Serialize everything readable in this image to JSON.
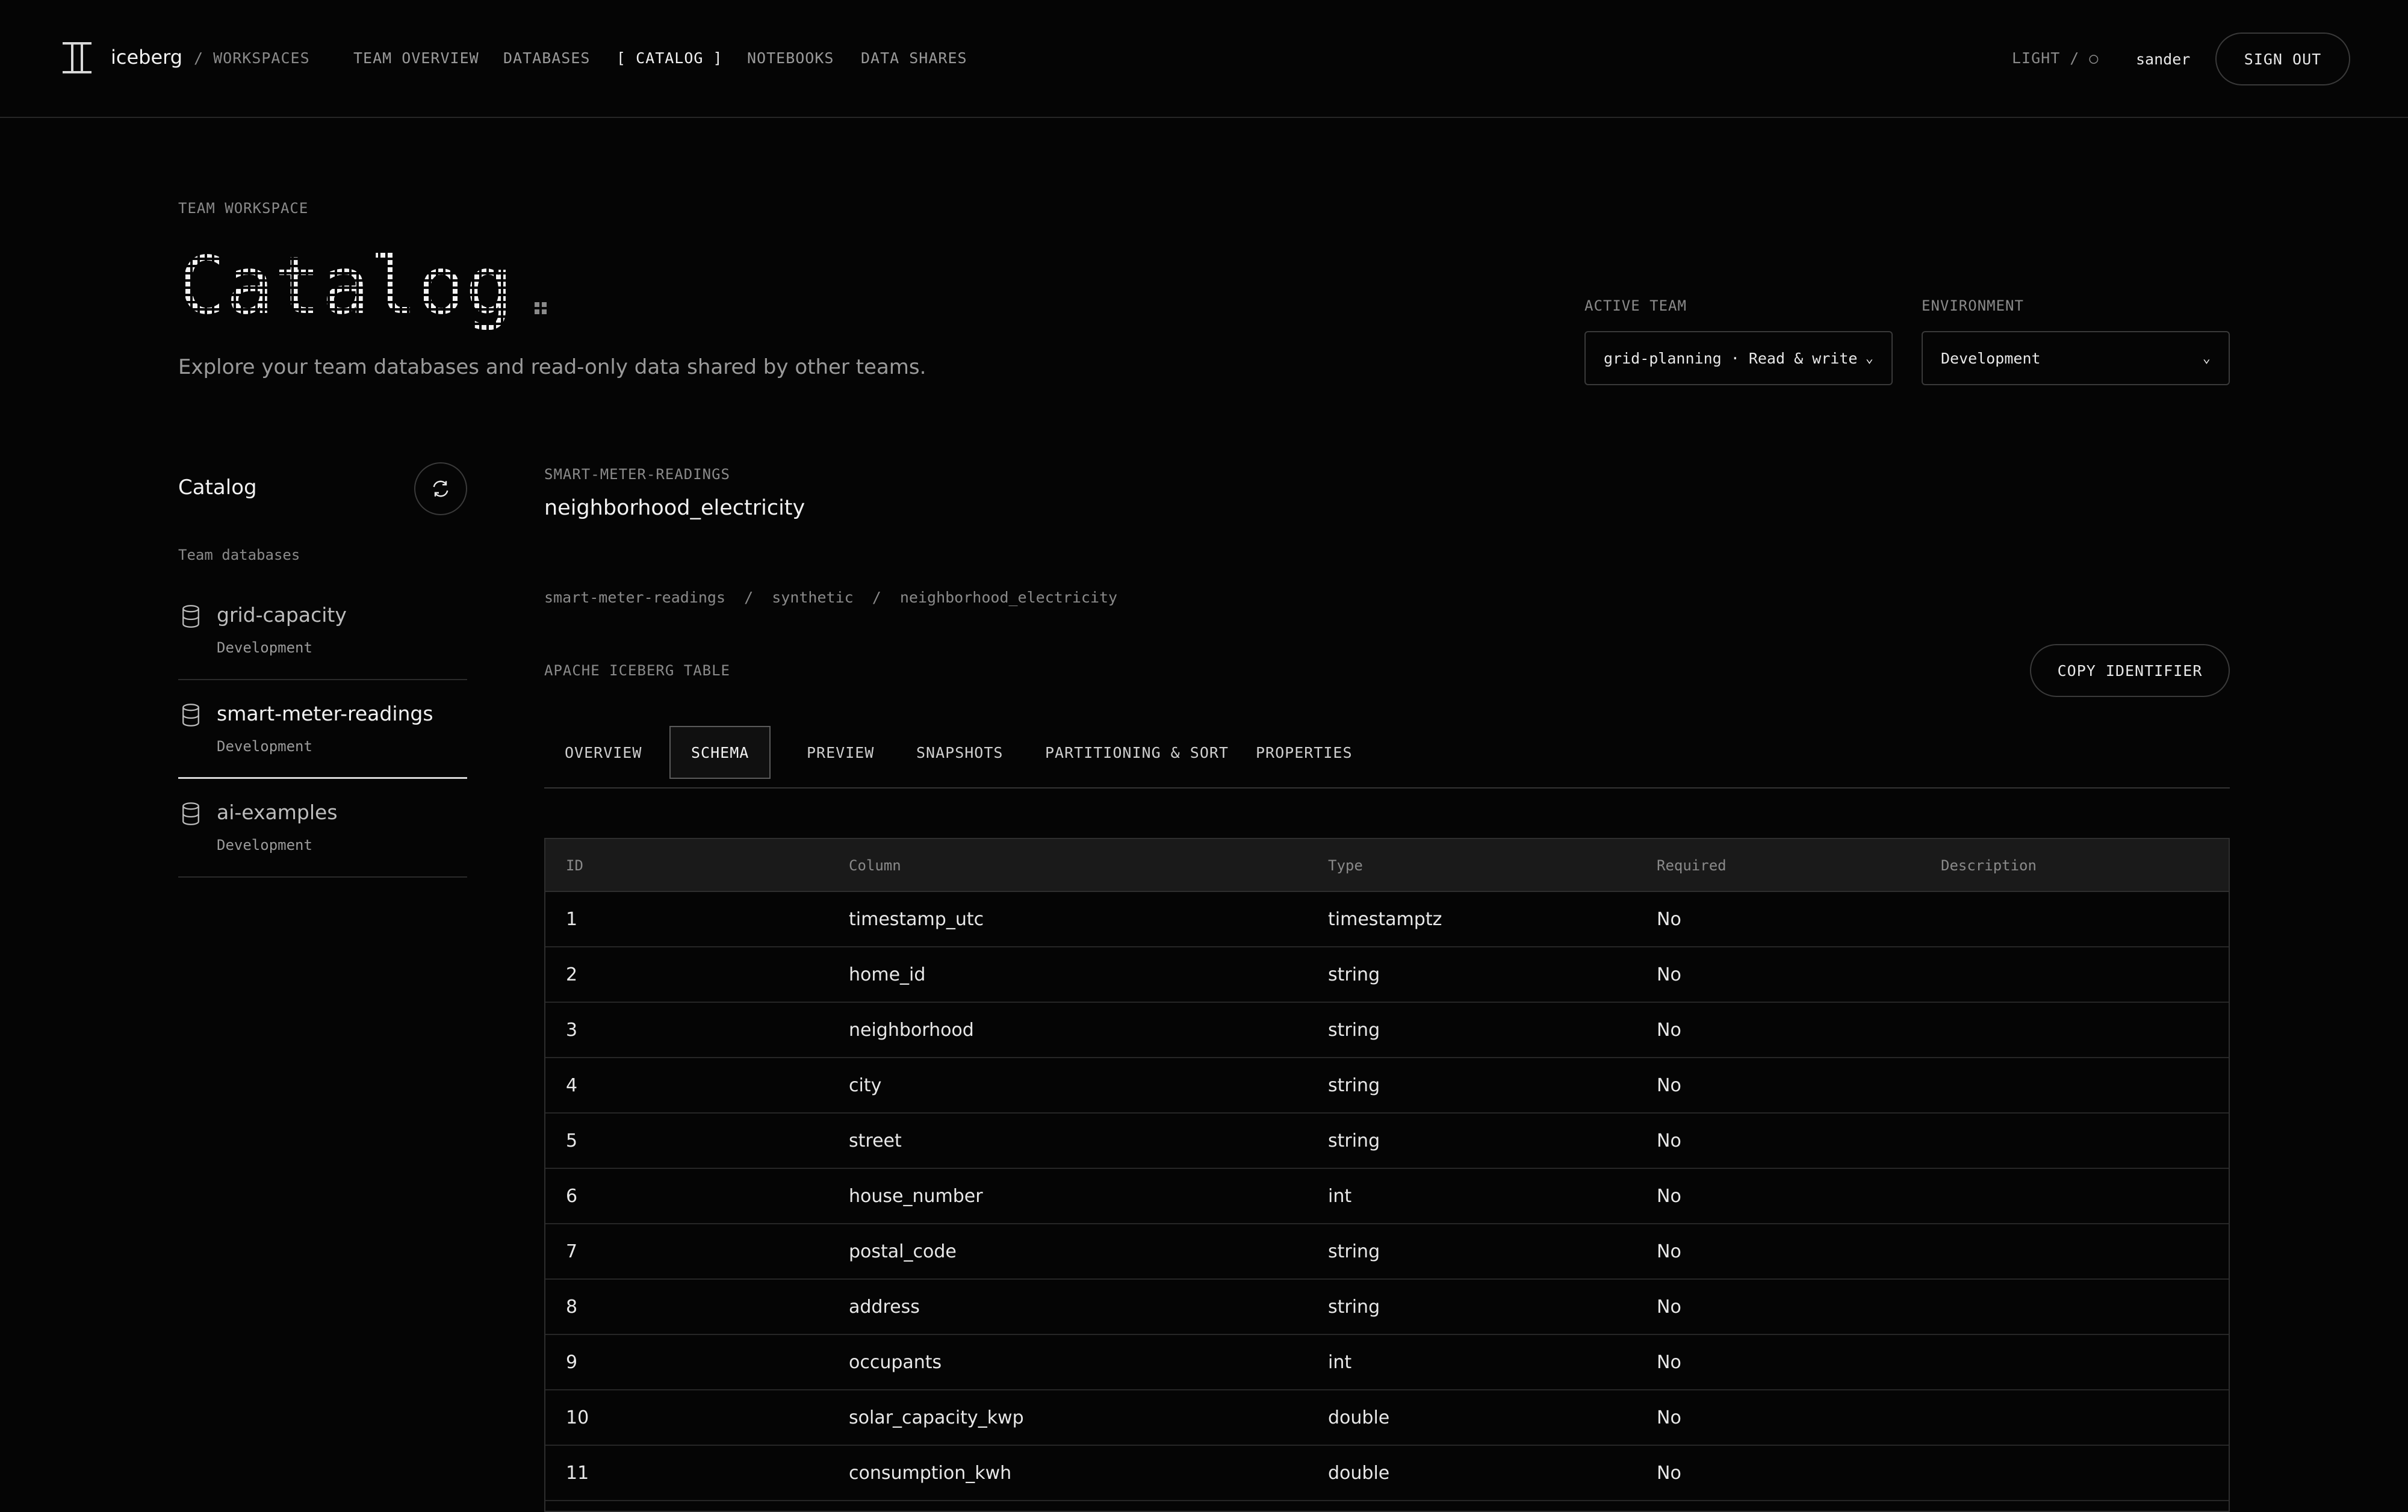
{
  "header": {
    "brand": "iceberg",
    "brand_sub": "/ WORKSPACES",
    "nav": [
      "TEAM OVERVIEW",
      "DATABASES",
      "[ CATALOG ]",
      "NOTEBOOKS",
      "DATA SHARES"
    ],
    "active_nav": "[ CATALOG ]",
    "theme_toggle": "LIGHT / ○",
    "user": "sander",
    "sign_out": "SIGN OUT"
  },
  "page": {
    "eyebrow": "TEAM WORKSPACE",
    "title": "Catalog",
    "subtitle": "Explore your team databases and read-only data shared by other teams."
  },
  "controls": {
    "team_label": "ACTIVE TEAM",
    "team_value": "grid-planning · Read & write",
    "env_label": "ENVIRONMENT",
    "env_value": "Development"
  },
  "sidebar": {
    "title": "Catalog",
    "group_label": "Team databases",
    "databases": [
      {
        "name": "grid-capacity",
        "env": "Development"
      },
      {
        "name": "smart-meter-readings",
        "env": "Development"
      },
      {
        "name": "ai-examples",
        "env": "Development"
      }
    ],
    "active": "smart-meter-readings"
  },
  "main": {
    "database_label": "SMART-METER-READINGS",
    "table_name": "neighborhood_electricity",
    "breadcrumb": [
      "smart-meter-readings",
      "synthetic",
      "neighborhood_electricity"
    ],
    "table_kind": "APACHE ICEBERG TABLE",
    "copy_button": "COPY IDENTIFIER",
    "tabs": [
      "OVERVIEW",
      "SCHEMA",
      "PREVIEW",
      "SNAPSHOTS",
      "PARTITIONING & SORT",
      "PROPERTIES"
    ],
    "active_tab": "SCHEMA"
  },
  "schema": {
    "columns": [
      "ID",
      "Column",
      "Type",
      "Required",
      "Description"
    ],
    "rows": [
      {
        "id": "1",
        "column": "timestamp_utc",
        "type": "timestamptz",
        "required": "No",
        "description": ""
      },
      {
        "id": "2",
        "column": "home_id",
        "type": "string",
        "required": "No",
        "description": ""
      },
      {
        "id": "3",
        "column": "neighborhood",
        "type": "string",
        "required": "No",
        "description": ""
      },
      {
        "id": "4",
        "column": "city",
        "type": "string",
        "required": "No",
        "description": ""
      },
      {
        "id": "5",
        "column": "street",
        "type": "string",
        "required": "No",
        "description": ""
      },
      {
        "id": "6",
        "column": "house_number",
        "type": "int",
        "required": "No",
        "description": ""
      },
      {
        "id": "7",
        "column": "postal_code",
        "type": "string",
        "required": "No",
        "description": ""
      },
      {
        "id": "8",
        "column": "address",
        "type": "string",
        "required": "No",
        "description": ""
      },
      {
        "id": "9",
        "column": "occupants",
        "type": "int",
        "required": "No",
        "description": ""
      },
      {
        "id": "10",
        "column": "solar_capacity_kwp",
        "type": "double",
        "required": "No",
        "description": ""
      },
      {
        "id": "11",
        "column": "consumption_kwh",
        "type": "double",
        "required": "No",
        "description": ""
      }
    ]
  },
  "colors": {
    "background": "#050505",
    "text": "#e8e8e8",
    "muted": "#8a8a8a",
    "border": "#2e2e2e"
  }
}
